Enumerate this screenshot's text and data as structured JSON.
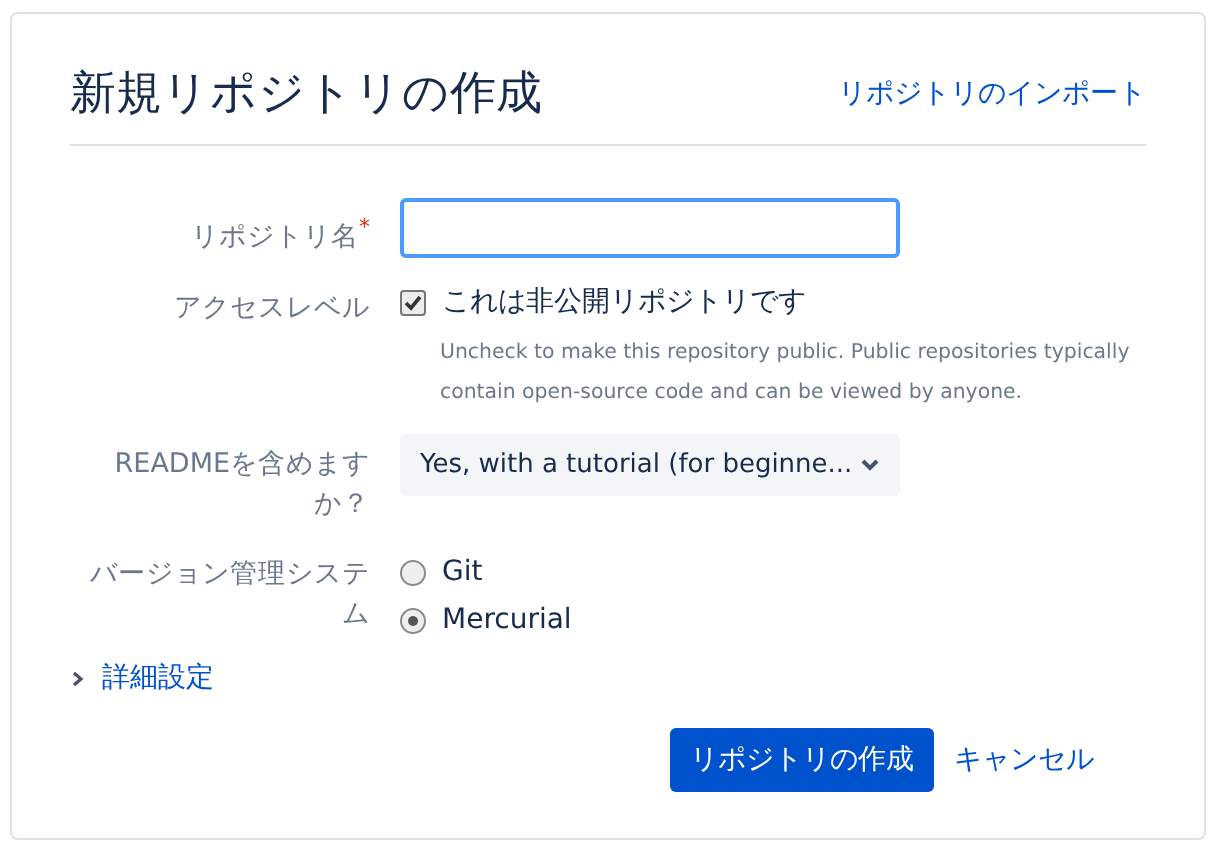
{
  "title": "新規リポジトリの作成",
  "import_link": "リポジトリのインポート",
  "name_field": {
    "label": "リポジトリ名",
    "required_mark": "*"
  },
  "access": {
    "label": "アクセスレベル",
    "checkbox_label": "これは非公開リポジトリです",
    "checked": true,
    "help": "Uncheck to make this repository public. Public repositories typically contain open-source code and can be viewed by anyone."
  },
  "readme": {
    "label": "READMEを含めますか？",
    "value": "Yes, with a tutorial (for beginne..."
  },
  "vcs": {
    "label": "バージョン管理システム",
    "options": [
      {
        "label": "Git",
        "selected": false
      },
      {
        "label": "Mercurial",
        "selected": true
      }
    ]
  },
  "advanced": {
    "label": "詳細設定",
    "expanded": false
  },
  "buttons": {
    "create": "リポジトリの作成",
    "cancel": "キャンセル"
  }
}
